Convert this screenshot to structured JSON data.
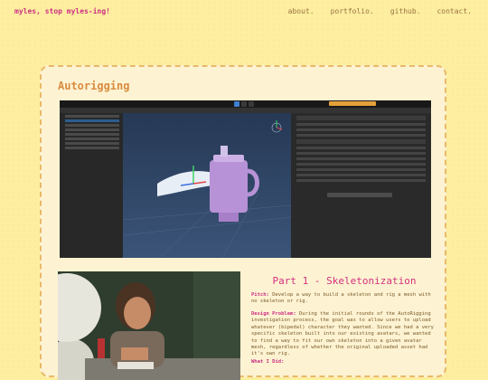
{
  "site": {
    "brand": "myles, stop myles-ing!",
    "nav": [
      "about.",
      "portfolio.",
      "github.",
      "contact."
    ]
  },
  "project": {
    "title": "Autorigging",
    "part_title": "Part 1 - Skeletonization",
    "pitch_label": "Pitch:",
    "pitch_text": "Develop a way to build a skeleton and rig a mesh with no skeleton or rig.",
    "problem_label": "Design Problem:",
    "problem_text": "During the initial rounds of the AutoRigging investigation process, the goal was to allow users to upload whatever (bipedal) character they wanted. Since we had a very specific skeleton built into our existing avatars, we wanted to find a way to fit our own skeleton into a given avatar mesh, regardless of whether the original uploaded asset had it's own rig.",
    "did_label": "What I Did:"
  }
}
